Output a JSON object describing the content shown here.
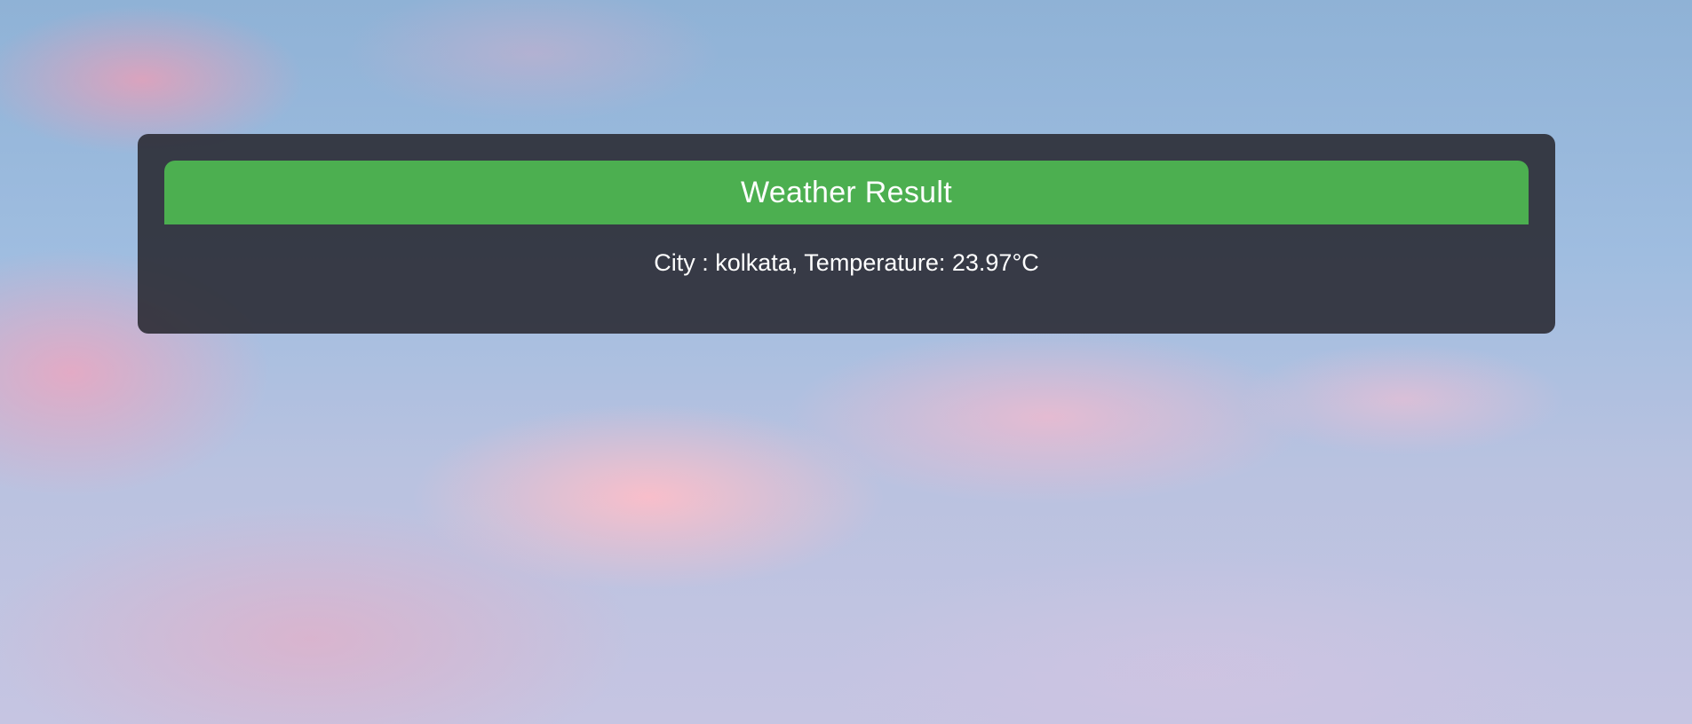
{
  "colors": {
    "header_background": "#4caf50",
    "card_background": "#2a2a30",
    "text": "#ffffff"
  },
  "weather_card": {
    "title": "Weather Result",
    "result_text": "City : kolkata, Temperature: 23.97°C"
  }
}
